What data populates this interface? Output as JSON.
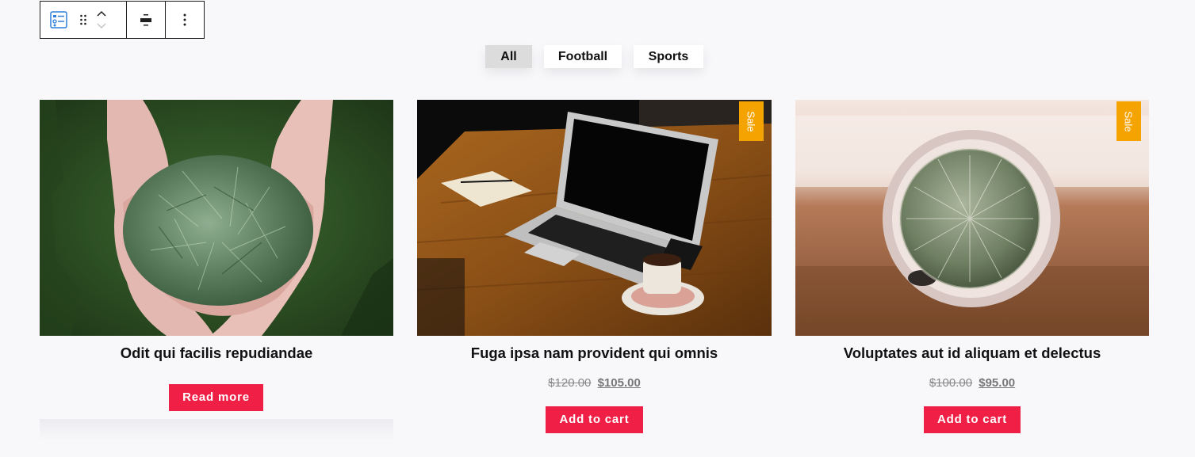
{
  "filters": [
    {
      "label": "All"
    },
    {
      "label": "Football"
    },
    {
      "label": "Sports"
    }
  ],
  "products": [
    {
      "title": "Odit qui facilis repudiandae",
      "button": "Read more"
    },
    {
      "title": "Fuga ipsa nam provident qui omnis",
      "badge": "Sale",
      "regular_price": "$120.00",
      "sale_price": "$105.00",
      "button": "Add to cart"
    },
    {
      "title": "Voluptates aut id aliquam et delectus",
      "badge": "Sale",
      "regular_price": "$100.00",
      "sale_price": "$95.00",
      "button": "Add to cart"
    }
  ],
  "colors": {
    "accent": "#ef1f45",
    "sale_badge": "#f5a300",
    "active_filter": "#dcdcdc",
    "background": "#f8f8fb"
  }
}
